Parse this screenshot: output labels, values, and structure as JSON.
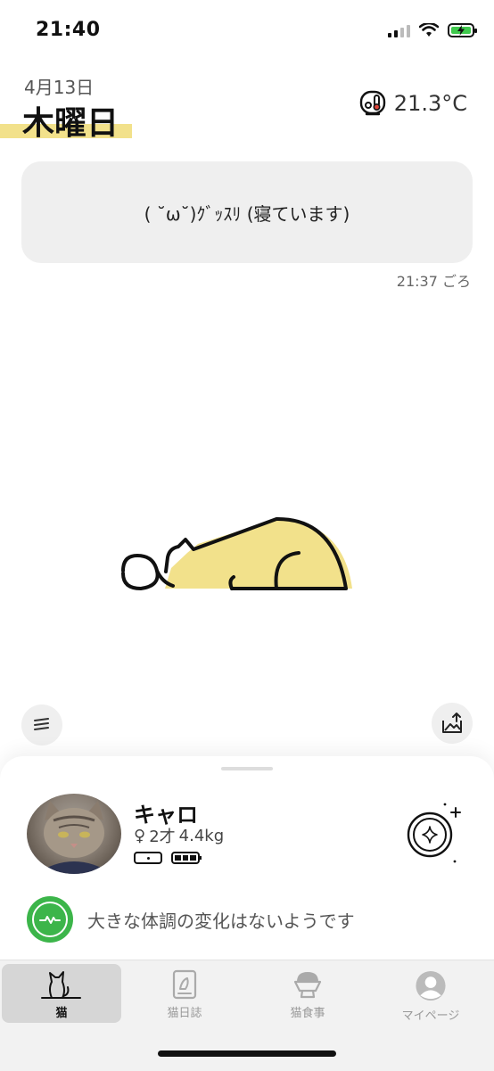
{
  "status_bar": {
    "time": "21:40"
  },
  "header": {
    "date": "4月13日",
    "weekday": "木曜日",
    "temperature": "21.3°C"
  },
  "message": {
    "text": "( ˘ω˘)ｸﾞｯｽﾘ (寝ています)",
    "time": "21:37 ごろ"
  },
  "cat": {
    "name": "キャロ",
    "gender_symbol": "♀",
    "age": "2才",
    "weight": "4.4kg"
  },
  "health": {
    "status": "大きな体調の変化はないようです"
  },
  "tabs": [
    {
      "label": "猫"
    },
    {
      "label": "猫日誌"
    },
    {
      "label": "猫食事"
    },
    {
      "label": "マイページ"
    }
  ],
  "colors": {
    "accent_yellow": "#f2e18b",
    "health_green": "#3cb54a",
    "battery_green": "#3fc94d"
  },
  "icons": {
    "weather": "thermometer-icon",
    "menu": "list-icon",
    "photo": "photo-upload-icon",
    "action": "sparkle-icon",
    "health": "heartbeat-icon"
  }
}
